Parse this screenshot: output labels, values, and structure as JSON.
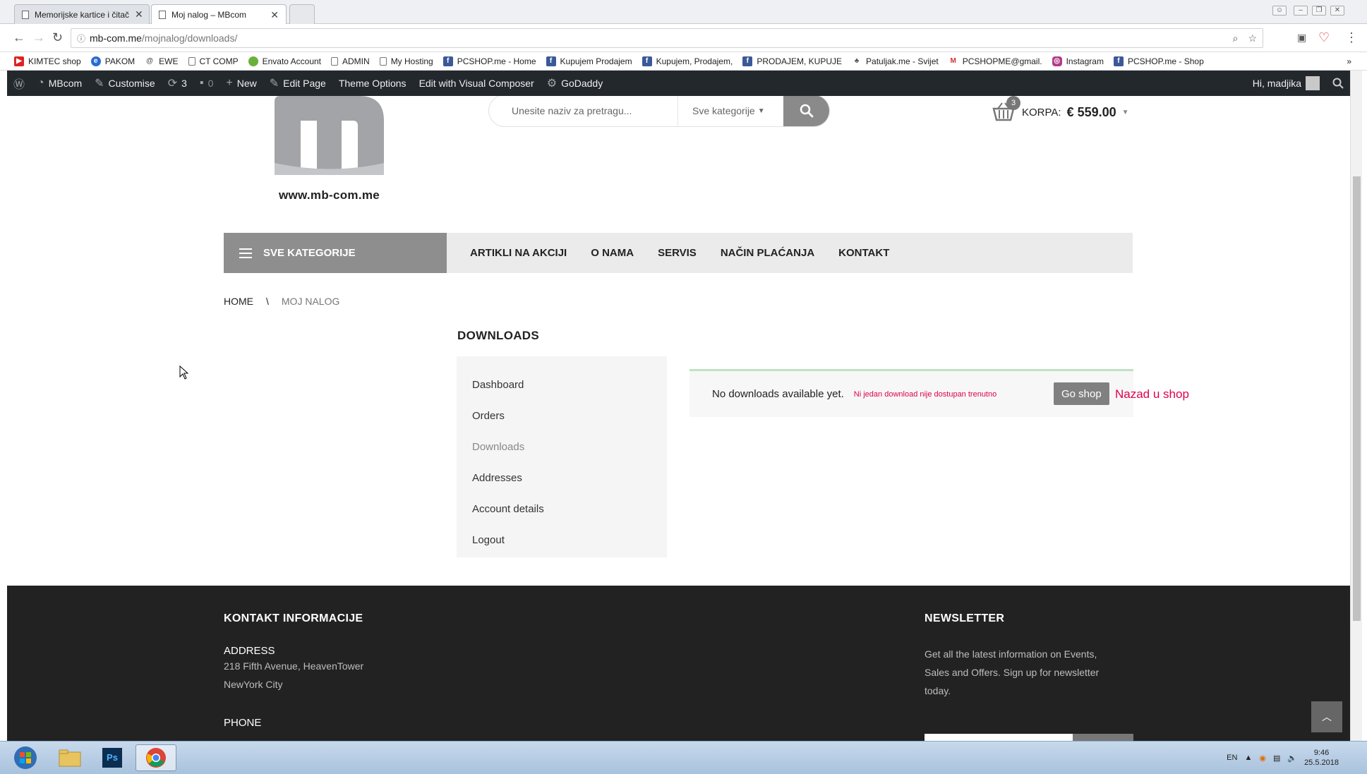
{
  "browser": {
    "tabs": [
      {
        "title": "Memorijske kartice i čitač"
      },
      {
        "title": "Moj nalog – MBcom"
      }
    ],
    "url_host": "mb-com.me",
    "url_path": "/mojnalog/downloads/",
    "bookmarks": [
      {
        "label": "KIMTEC shop",
        "icon": "red-icon"
      },
      {
        "label": "PAKOM",
        "icon": "globe-icon"
      },
      {
        "label": "EWE",
        "icon": "swirl-icon"
      },
      {
        "label": "CT COMP",
        "icon": "page-icon"
      },
      {
        "label": "Envato Account",
        "icon": "leaf-icon"
      },
      {
        "label": "ADMIN",
        "icon": "page-icon"
      },
      {
        "label": "My Hosting",
        "icon": "page-icon"
      },
      {
        "label": "PCSHOP.me - Home",
        "icon": "facebook-icon"
      },
      {
        "label": "Kupujem Prodajem",
        "icon": "facebook-icon"
      },
      {
        "label": "Kupujem, Prodajem,",
        "icon": "facebook-icon"
      },
      {
        "label": "PRODAJEM, KUPUJE",
        "icon": "facebook-icon"
      },
      {
        "label": "Patuljak.me - Svijet",
        "icon": "gnome-icon"
      },
      {
        "label": "PCSHOPME@gmail.",
        "icon": "gmail-icon"
      },
      {
        "label": "Instagram",
        "icon": "instagram-icon"
      },
      {
        "label": "PCSHOP.me - Shop",
        "icon": "facebook-icon"
      }
    ]
  },
  "wpbar": {
    "site": "MBcom",
    "customise": "Customise",
    "updates": "3",
    "comments": "0",
    "new": "New",
    "edit_page": "Edit Page",
    "theme_options": "Theme Options",
    "visual_composer": "Edit with Visual Composer",
    "godaddy": "GoDaddy",
    "greeting": "Hi, madjika"
  },
  "header": {
    "logo_text": "www.mb-com.me",
    "search_placeholder": "Unesite naziv za pretragu...",
    "search_category": "Sve kategorije",
    "cart_count": "3",
    "cart_label": "KORPA:",
    "cart_total": "€ 559.00"
  },
  "menu": {
    "all_categories": "SVE KATEGORIJE",
    "items": [
      "ARTIKLI NA AKCIJI",
      "O NAMA",
      "SERVIS",
      "NAČIN PLAĆANJA",
      "KONTAKT"
    ]
  },
  "breadcrumb": {
    "home": "HOME",
    "separator": "\\",
    "current": "MOJ NALOG"
  },
  "account": {
    "title": "DOWNLOADS",
    "nav": [
      "Dashboard",
      "Orders",
      "Downloads",
      "Addresses",
      "Account details",
      "Logout"
    ],
    "active_index": 2,
    "notice": "No downloads available yet.",
    "notice_note": "Ni jedan download nije dostupan trenutno",
    "go_shop": "Go shop",
    "back_to_shop": "Nazad u shop"
  },
  "footer": {
    "contact_title": "KONTAKT INFORMACIJE",
    "address_label": "ADDRESS",
    "address_line1": "218 Fifth Avenue, HeavenTower",
    "address_line2": "NewYork City",
    "phone_label": "PHONE",
    "newsletter_title": "NEWSLETTER",
    "newsletter_line1": "Get all the latest information on Events,",
    "newsletter_line2": "Sales and Offers. Sign up for newsletter",
    "newsletter_line3": "today."
  },
  "taskbar": {
    "lang": "EN",
    "time": "9:46",
    "date": "25.5.2018"
  },
  "colors": {
    "accent_gray": "#8e8e8e",
    "notice_red": "#e0004d",
    "wp_bar": "#23282d",
    "footer": "#222222"
  }
}
